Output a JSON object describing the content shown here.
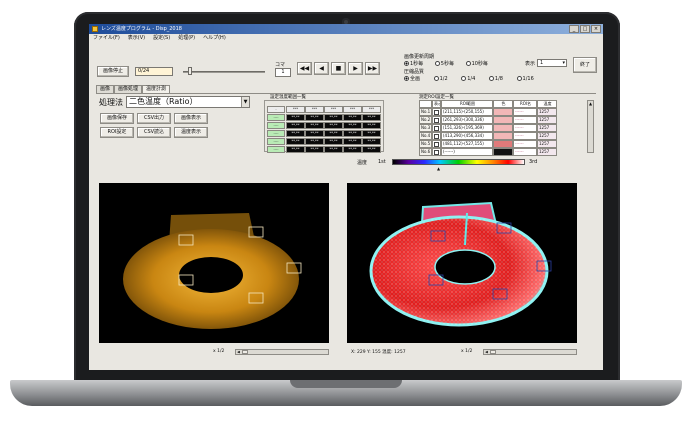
{
  "window": {
    "title": "レンズ温度プログラム - Disp_2018",
    "minimize": "_",
    "maximize": "□",
    "close": "×"
  },
  "menu": [
    "ファイル(F)",
    "表示(V)",
    "設定(S)",
    "処理(P)",
    "ヘルプ(H)"
  ],
  "toolbar": {
    "stop_button": "画像停止",
    "counter_value": "0/24",
    "frame_label": "コマ",
    "frame_value": "1",
    "media": [
      "◀◀",
      "◀",
      "■",
      "▶",
      "▶▶"
    ],
    "period_label": "画像更新周期",
    "period_options": [
      {
        "label": "1秒毎",
        "selected": true
      },
      {
        "label": "5秒毎",
        "selected": false
      },
      {
        "label": "10秒毎",
        "selected": false
      }
    ],
    "display_label": "表示",
    "display_value": "1",
    "quality_label": "圧縮品質",
    "quality_options": [
      {
        "label": "全画",
        "selected": true
      },
      {
        "label": "1/2",
        "selected": false
      },
      {
        "label": "1/4",
        "selected": false
      },
      {
        "label": "1/8",
        "selected": false
      },
      {
        "label": "1/16",
        "selected": false
      }
    ],
    "end_button": "終了"
  },
  "tabs": [
    {
      "label": "画像",
      "active": false
    },
    {
      "label": "画像処理",
      "active": false
    },
    {
      "label": "温度計測",
      "active": true
    }
  ],
  "processing": {
    "method_label": "処理法",
    "method_value": "二色温度（Ratio）",
    "buttons": [
      "画像保存",
      "CSV出力",
      "画像表示",
      "ROI設定",
      "CSV読込",
      "温度表示"
    ]
  },
  "grid": {
    "title": "設定温度範囲一覧",
    "header": [
      "-",
      "***",
      "***",
      "***",
      "***",
      "***"
    ],
    "rows": [
      [
        "----",
        "**.**",
        "**.**",
        "**.**",
        "**.**",
        "**.**"
      ],
      [
        "----",
        "**.**",
        "**.**",
        "**.**",
        "**.**",
        "**.**"
      ],
      [
        "----",
        "**.**",
        "**.**",
        "**.**",
        "**.**",
        "**.**"
      ],
      [
        "----",
        "**.**",
        "**.**",
        "**.**",
        "**.**",
        "**.**"
      ],
      [
        "----",
        "**.**",
        "**.**",
        "**.**",
        "**.**",
        "**.**"
      ]
    ]
  },
  "roi_table": {
    "title": "測定ROI設定一覧",
    "headers": [
      "",
      "表示",
      "ROI範囲",
      "色",
      "ROI名",
      "温度"
    ],
    "rows": [
      {
        "id": "No.1",
        "range": "(211,115)-(250,155)",
        "color": "#f2b7b7",
        "name": "------",
        "temp": "1257"
      },
      {
        "id": "No.2",
        "range": "(261,293)-(300,336)",
        "color": "#f2b7b7",
        "name": "------",
        "temp": "1257"
      },
      {
        "id": "No.3",
        "range": "(151,326)-(195,369)",
        "color": "#f2b7b7",
        "name": "------",
        "temp": "1257"
      },
      {
        "id": "No.4",
        "range": "(413,290)-(456,334)",
        "color": "#f2b7b7",
        "name": "------",
        "temp": "1257"
      },
      {
        "id": "No.5",
        "range": "(481,112)-(527,155)",
        "color": "#e07a7a",
        "name": "------",
        "temp": "1257"
      },
      {
        "id": "No.6",
        "range": "(------)",
        "color": "#111111",
        "name": "------",
        "temp": "1257"
      }
    ]
  },
  "palette": {
    "label": "温度",
    "min": "1st",
    "max": "3rd"
  },
  "status": {
    "left_zoom": "x 1/2",
    "right_info": "X: 229  Y: 155  温度: 1257",
    "right_zoom": "x 1/2"
  },
  "colors": {
    "title_start": "#1e4c9a",
    "title_end": "#8fb1dd",
    "ring_glow": "#e9a21a",
    "thermal_red": "#ff2b2b",
    "thermal_cyan": "#59e6e6"
  }
}
